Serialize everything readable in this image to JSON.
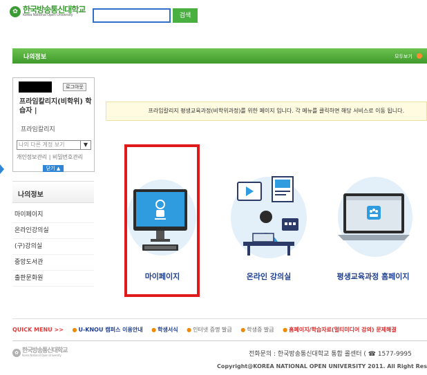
{
  "header": {
    "logo_ko": "한국방송통신대학교",
    "logo_en": "Korea National Open University",
    "search_placeholder": "",
    "search_button": "검색"
  },
  "titlebar": {
    "title": "나의정보",
    "view_all": "모두보기"
  },
  "user": {
    "logout": "로그아웃",
    "program": "프라임칼리지(비학위) 학습자 |",
    "program_sub": "프라임칼리지",
    "account_select": "나의 다른 계정 보기",
    "link_info": "개인정보관리",
    "link_pw": "비밀번호관리",
    "close": "닫기"
  },
  "sidebar": {
    "title": "나의정보",
    "items": [
      "마이페이지",
      "온라인강의실",
      "(구)강의실",
      "중앙도서관",
      "출판문화원"
    ]
  },
  "notice": "프라임칼리지 평생교육과정(비학위과정)를 위한 페이지 입니다. 각 메뉴를 클릭하면 해당 서비스로 이동 됩니다.",
  "cards": [
    {
      "label": "마이페이지"
    },
    {
      "label": "온라인 강의실"
    },
    {
      "label": "평생교육과정 홈페이지"
    }
  ],
  "quick_menu": {
    "title": "QUICK MENU >>",
    "items": [
      "U-KNOU 캠퍼스 이용안내",
      "학생서식",
      "인터넷 증명 발급",
      "학생증 발급",
      "홈페이지/학습자료(멀티미디어 강의) 문제해결"
    ]
  },
  "footer": {
    "logo_ko": "한국방송통신대학교",
    "logo_en": "Korea National Open University",
    "contact": "전화문의 : 한국방송통신대학교 통합 콜센터 ( ☎ 1577-9995",
    "copyright": "Copyright@KOREA NATIONAL OPEN UNIVERSITY 2011. All Right Reserve"
  },
  "colors": {
    "brand_green": "#3d9b35",
    "highlight_red": "#e01a1a",
    "link_blue": "#2f86d6"
  }
}
